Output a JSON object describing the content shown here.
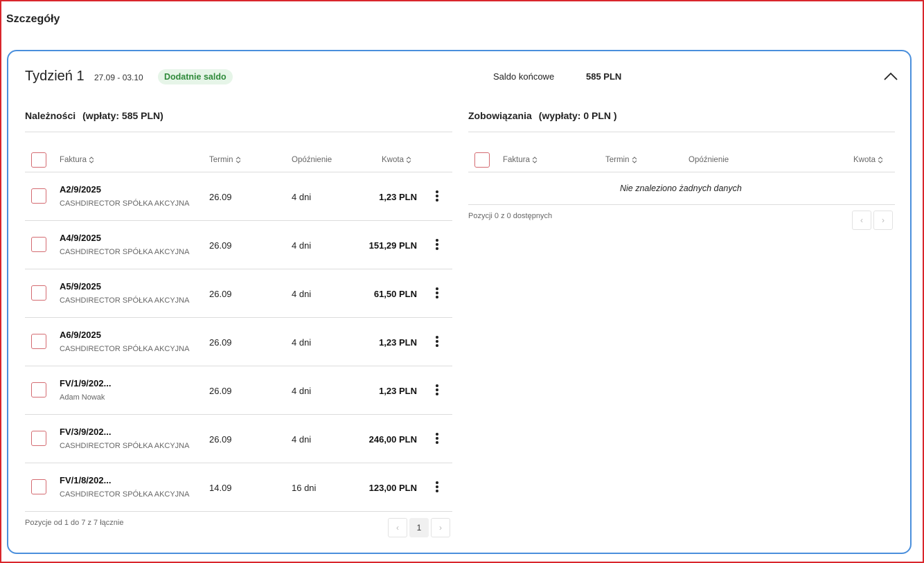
{
  "page_title": "Szczegóły",
  "colors": {
    "frame": "#d9262c",
    "card_border": "#4a8fdc",
    "badge_bg": "#e6f5e8",
    "badge_text": "#2f8a3a",
    "checkbox": "#d46a70"
  },
  "week": {
    "title": "Tydzień 1",
    "range": "27.09 - 03.10",
    "badge": "Dodatnie saldo",
    "saldo_label": "Saldo końcowe",
    "saldo_value": "585 PLN",
    "collapse_icon": "chevron-up-icon"
  },
  "receivables": {
    "title": "Należności",
    "subtitle": "(wpłaty: 585 PLN)",
    "columns": {
      "invoice": "Faktura",
      "term": "Termin",
      "delay": "Opóźnienie",
      "amount": "Kwota"
    },
    "rows": [
      {
        "invoice": "A2/9/2025",
        "company": "CASHDIRECTOR SPÓŁKA AKCYJNA",
        "term": "26.09",
        "delay": "4 dni",
        "amount": "1,23 PLN"
      },
      {
        "invoice": "A4/9/2025",
        "company": "CASHDIRECTOR SPÓŁKA AKCYJNA",
        "term": "26.09",
        "delay": "4 dni",
        "amount": "151,29 PLN"
      },
      {
        "invoice": "A5/9/2025",
        "company": "CASHDIRECTOR SPÓŁKA AKCYJNA",
        "term": "26.09",
        "delay": "4 dni",
        "amount": "61,50 PLN"
      },
      {
        "invoice": "A6/9/2025",
        "company": "CASHDIRECTOR SPÓŁKA AKCYJNA",
        "term": "26.09",
        "delay": "4 dni",
        "amount": "1,23 PLN"
      },
      {
        "invoice": "FV/1/9/202...",
        "company": "Adam Nowak",
        "term": "26.09",
        "delay": "4 dni",
        "amount": "1,23 PLN"
      },
      {
        "invoice": "FV/3/9/202...",
        "company": "CASHDIRECTOR SPÓŁKA AKCYJNA",
        "term": "26.09",
        "delay": "4 dni",
        "amount": "246,00 PLN"
      },
      {
        "invoice": "FV/1/8/202...",
        "company": "CASHDIRECTOR SPÓŁKA AKCYJNA",
        "term": "14.09",
        "delay": "16 dni",
        "amount": "123,00 PLN"
      }
    ],
    "footer": "Pozycje od 1 do 7 z 7 łącznie",
    "pagination": {
      "prev": "‹",
      "page": "1",
      "next": "›"
    }
  },
  "liabilities": {
    "title": "Zobowiązania",
    "subtitle": "(wypłaty: 0 PLN )",
    "columns": {
      "invoice": "Faktura",
      "term": "Termin",
      "delay": "Opóźnienie",
      "amount": "Kwota"
    },
    "empty_message": "Nie znaleziono żadnych danych",
    "footer": "Pozycji 0 z 0 dostępnych",
    "pagination": {
      "prev": "‹",
      "next": "›"
    }
  }
}
